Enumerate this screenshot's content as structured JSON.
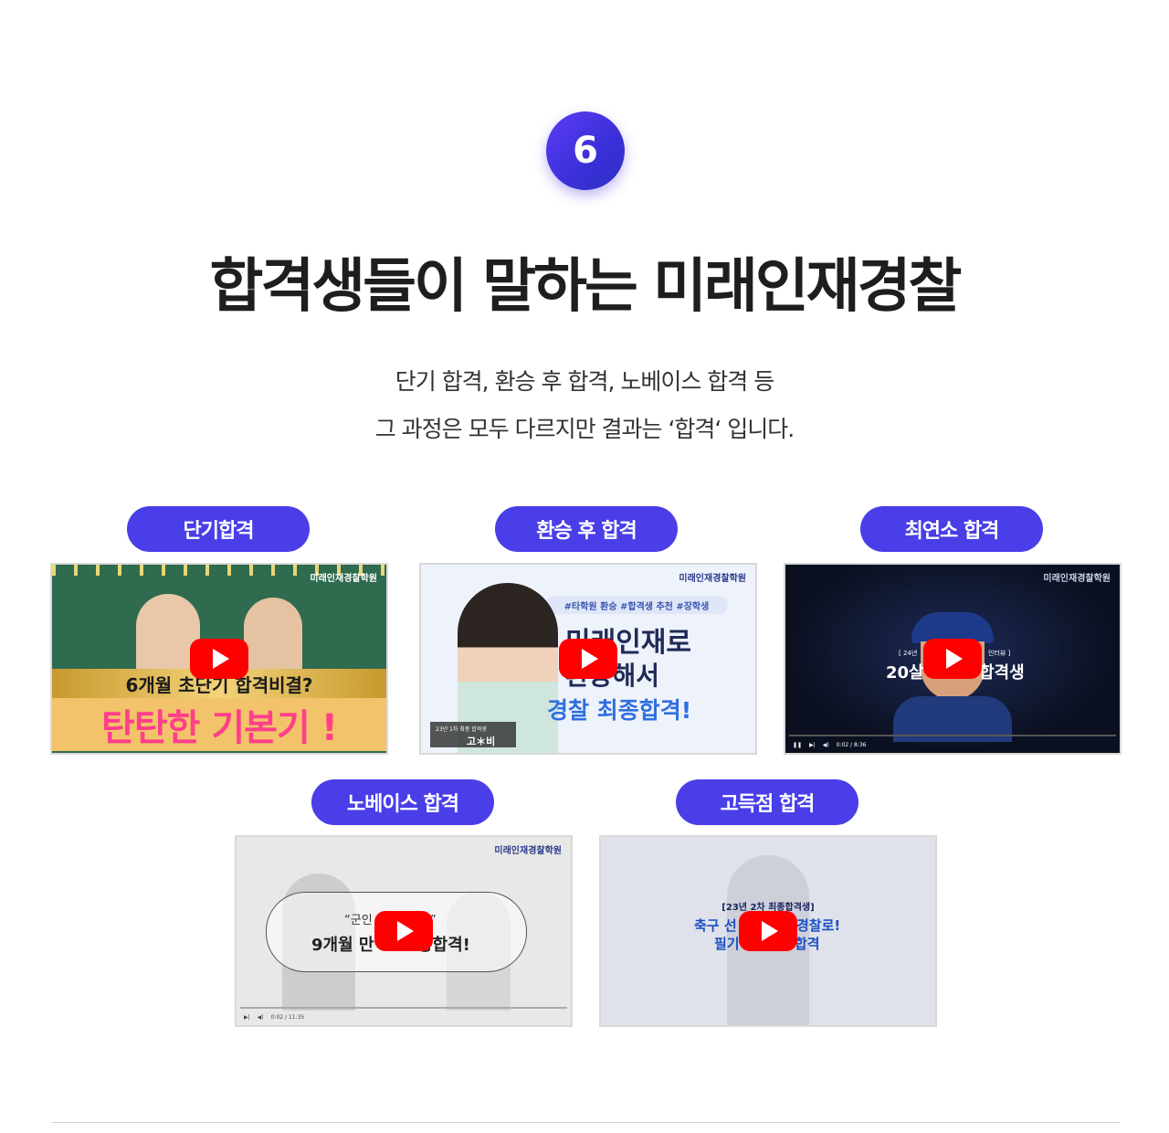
{
  "section": {
    "number": "6",
    "title": "합격생들이 말하는 미래인재경찰",
    "subtitle_line1": "단기 합격, 환승 후 합격, 노베이스 합격 등",
    "subtitle_line2": "그 과정은 모두 다르지만 결과는 ‘합격‘ 입니다."
  },
  "videos": [
    {
      "category": "단기합격",
      "logo": "미래인재경찰학원",
      "headline": "6개월 초단기 합격비결?",
      "big_text": "탄탄한 기본기 !"
    },
    {
      "category": "환승 후 합격",
      "logo": "미래인재경찰학원",
      "tags": "#타학원 환승 #합격생 추천 #장학생",
      "line1": "미래인재로",
      "line2": "환승해서",
      "line3": "경찰 최종합격!",
      "caption_small": "23년 1차 최종 합격생",
      "caption_name": "고＊비"
    },
    {
      "category": "최연소 합격",
      "logo": "미래인재경찰학원",
      "left_text": "[ 24년",
      "right_text": "인터뷰 ]",
      "headline_left": "20살",
      "headline_right": "합격생",
      "time": "0:02 / 8:36"
    },
    {
      "category": "노베이스 합격",
      "logo": "미래인재경찰학원",
      "quote": "“군인",
      "quote_end": "찰”",
      "headline_left": "9개월 만",
      "headline_right": "종합격!",
      "time": "0:02 / 11:35"
    },
    {
      "category": "고득점 합격",
      "tag": "[23년 2차 최종합격생]",
      "line1_left": "축구 선",
      "line1_right": "경찰로!",
      "line2_left": "필기",
      "line2_right": "합격"
    }
  ],
  "colors": {
    "accent": "#4a3ee8",
    "play": "#ff0000"
  }
}
